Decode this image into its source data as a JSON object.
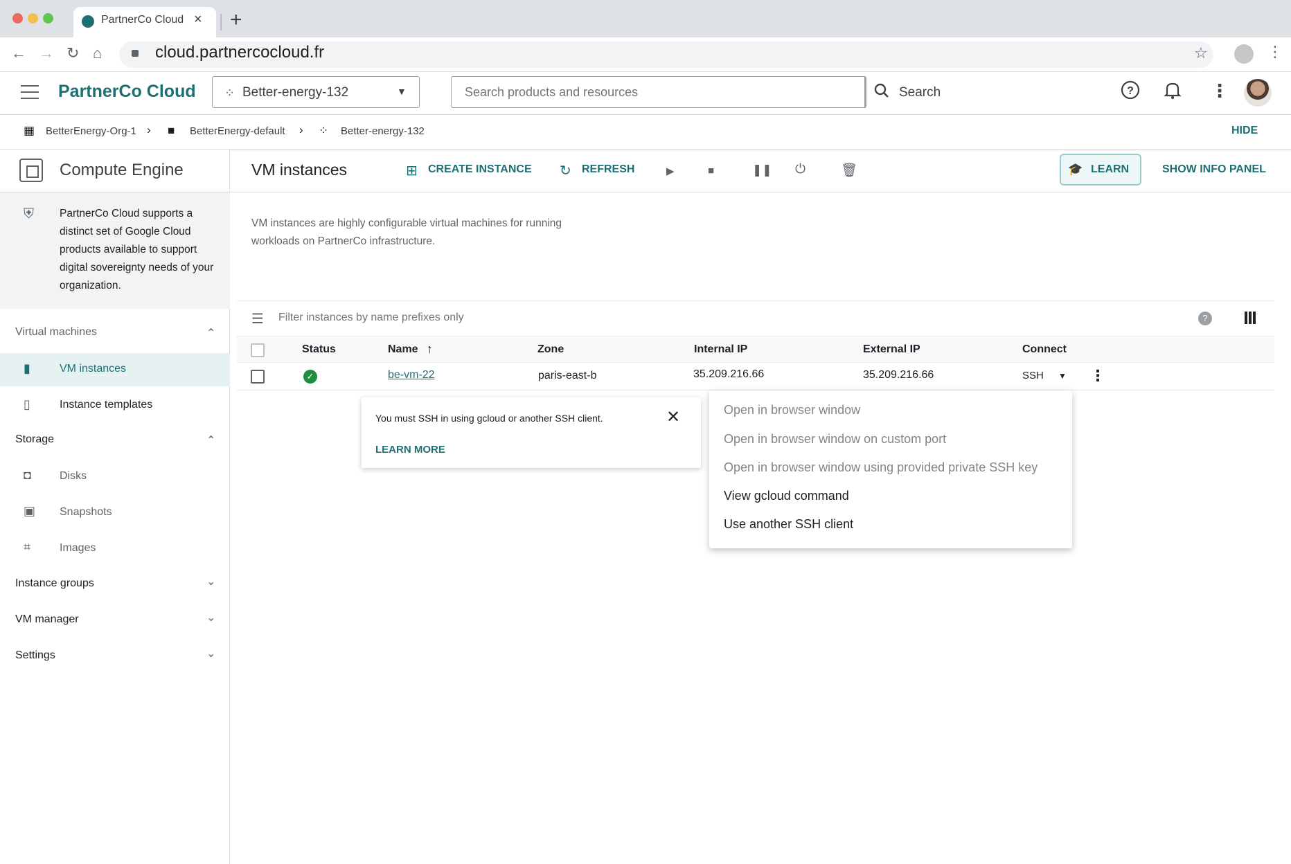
{
  "browser": {
    "tab_title": "PartnerCo Cloud",
    "url": "cloud.partnercocloud.fr"
  },
  "header": {
    "brand": "PartnerCo Cloud",
    "project": "Better-energy-132",
    "search_placeholder": "Search products and resources",
    "search_button": "Search"
  },
  "breadcrumb": {
    "items": [
      "BetterEnergy-Org-1",
      "BetterEnergy-default",
      "Better-energy-132"
    ],
    "hide": "HIDE"
  },
  "sidebar": {
    "title": "Compute Engine",
    "info": "PartnerCo Cloud supports a distinct set of Google Cloud products available to support digital sovereignty needs of your organization.",
    "sections": [
      {
        "label": "Virtual machines",
        "items": [
          "VM instances",
          "Instance templates"
        ]
      },
      {
        "label": "Storage",
        "items": [
          "Disks",
          "Snapshots",
          "Images"
        ]
      },
      {
        "label": "Instance groups"
      },
      {
        "label": "VM manager"
      },
      {
        "label": "Settings"
      }
    ]
  },
  "main": {
    "title": "VM instances",
    "create_instance": "CREATE INSTANCE",
    "refresh": "REFRESH",
    "learn": "LEARN",
    "show_info_panel": "SHOW INFO PANEL",
    "description": "VM instances are highly configurable virtual machines for running workloads on PartnerCo infrastructure.",
    "filter_placeholder": "Filter instances by name prefixes only",
    "columns": [
      "Status",
      "Name",
      "Zone",
      "Internal IP",
      "External IP",
      "Connect"
    ],
    "rows": [
      {
        "name": "be-vm-22",
        "zone": "paris-east-b",
        "internal_ip": "35.209.216.66",
        "external_ip": "35.209.216.66",
        "connect": "SSH"
      }
    ]
  },
  "tooltip": {
    "text": "You must SSH in using gcloud or another SSH client.",
    "link": "LEARN MORE"
  },
  "ssh_menu": {
    "items": [
      {
        "label": "Open in browser window",
        "enabled": false
      },
      {
        "label": "Open in browser window on custom port",
        "enabled": false
      },
      {
        "label": "Open in browser window using provided private SSH key",
        "enabled": false
      },
      {
        "label": "View gcloud command",
        "enabled": true
      },
      {
        "label": "Use another SSH client",
        "enabled": true
      }
    ]
  },
  "colors": {
    "accent": "#1e6f73",
    "status_ok": "#1e8e3e"
  }
}
